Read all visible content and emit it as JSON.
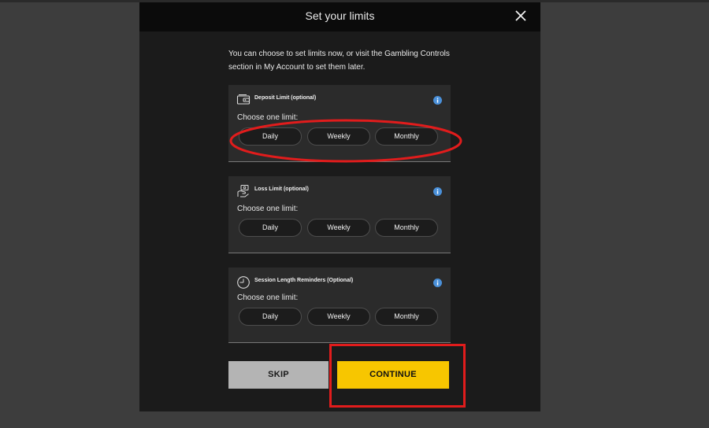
{
  "modal": {
    "title": "Set your limits",
    "intro_line1": "You can choose to set limits now, or visit the Gambling Controls",
    "intro_line2": "section in My Account to set them later."
  },
  "cards": [
    {
      "title": "Deposit Limit (optional)",
      "icon": "wallet-icon",
      "choose_label": "Choose one limit:",
      "options": [
        "Daily",
        "Weekly",
        "Monthly"
      ]
    },
    {
      "title": "Loss Limit (optional)",
      "icon": "money-hand-icon",
      "choose_label": "Choose one limit:",
      "options": [
        "Daily",
        "Weekly",
        "Monthly"
      ]
    },
    {
      "title": "Session Length Reminders (Optional)",
      "icon": "clock-icon",
      "choose_label": "Choose one limit:",
      "options": [
        "Daily",
        "Weekly",
        "Monthly"
      ]
    }
  ],
  "actions": {
    "skip_label": "SKIP",
    "continue_label": "CONTINUE"
  },
  "colors": {
    "accent_yellow": "#f7c600",
    "annotation_red": "#e11c1c",
    "info_blue": "#4a90d9"
  }
}
